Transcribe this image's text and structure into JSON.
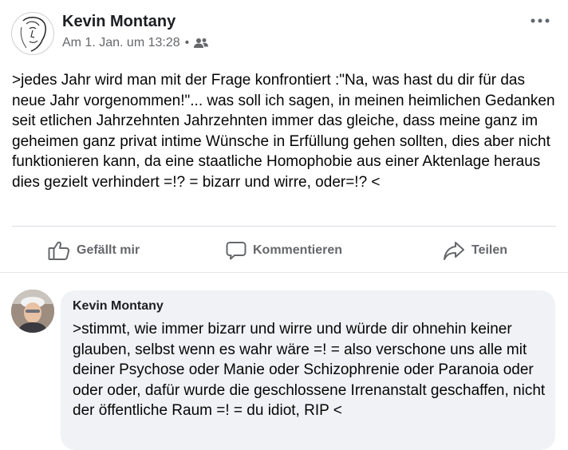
{
  "post": {
    "author": "Kevin Montany",
    "timestamp": "Am 1. Jan. um 13:28",
    "separator": "•",
    "audience_icon": "friends-icon",
    "text": ">jedes Jahr wird man mit der Frage konfrontiert :\"Na, was hast du dir für das neue Jahr vorgenommen!\"... was soll ich sagen, in meinen heimlichen Gedanken seit etlichen Jahrzehnten Jahrzehnten immer das gleiche, dass meine ganz im geheimen ganz privat intime Wünsche in Erfüllung gehen sollten, dies aber nicht funktionieren kann, da eine staatliche Homophobie aus einer Aktenlage heraus dies gezielt verhindert =!? = bizarr und wirre, oder=!? <"
  },
  "actions": {
    "like": "Gefällt mir",
    "comment": "Kommentieren",
    "share": "Teilen"
  },
  "comment": {
    "author": "Kevin Montany",
    "text": ">stimmt, wie immer bizarr und wirre und würde dir ohnehin keiner glauben, selbst wenn es wahr wäre =! = also verschone uns alle mit deiner Psychose oder Manie oder Schizophrenie oder Paranoia oder oder oder, dafür wurde die geschlossene Irrenanstalt geschaffen, nicht der öffentliche Raum =! = du idiot, RIP <"
  },
  "colors": {
    "secondary_text": "#65676b",
    "bubble_bg": "#f0f2f5",
    "divider": "#dadde1"
  }
}
